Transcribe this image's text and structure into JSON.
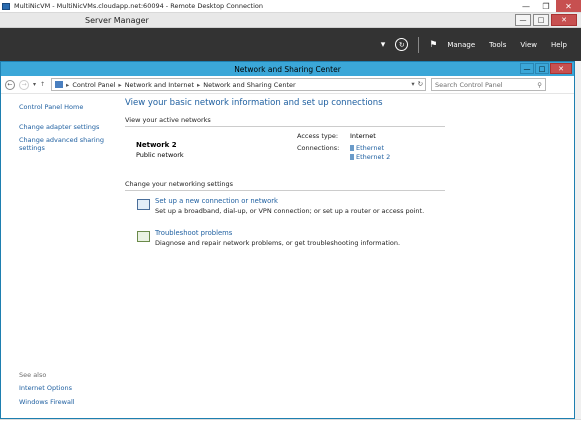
{
  "rdc": {
    "title": "MultiNicVM - MultiNicVMs.cloudapp.net:60094 - Remote Desktop Connection"
  },
  "server_manager": {
    "title": "Server Manager",
    "toolbar": {
      "manage": "Manage",
      "tools": "Tools",
      "view": "View",
      "help": "Help"
    }
  },
  "nsc": {
    "window_title": "Network and Sharing Center",
    "address": {
      "crumbs": [
        "Control Panel",
        "Network and Internet",
        "Network and Sharing Center"
      ]
    },
    "search_placeholder": "Search Control Panel",
    "left_nav": {
      "items": [
        "Control Panel Home",
        "Change adapter settings",
        "Change advanced sharing settings"
      ],
      "see_also_label": "See also",
      "see_also": [
        "Internet Options",
        "Windows Firewall"
      ]
    },
    "main": {
      "heading": "View your basic network information and set up connections",
      "active_networks_label": "View your active networks",
      "network": {
        "name": "Network  2",
        "type": "Public network",
        "access_type_label": "Access type:",
        "access_type_value": "Internet",
        "connections_label": "Connections:",
        "connections": [
          "Ethernet",
          "Ethernet 2"
        ]
      },
      "change_settings_label": "Change your networking settings",
      "tasks": [
        {
          "link": "Set up a new connection or network",
          "desc": "Set up a broadband, dial-up, or VPN connection; or set up a router or access point."
        },
        {
          "link": "Troubleshoot problems",
          "desc": "Diagnose and repair network problems, or get troubleshooting information."
        }
      ]
    }
  },
  "colors": {
    "accent_title": "#3ba7d8",
    "link": "#1e5fa0",
    "toolbar_bg": "#333333",
    "close_red": "#c75050"
  }
}
